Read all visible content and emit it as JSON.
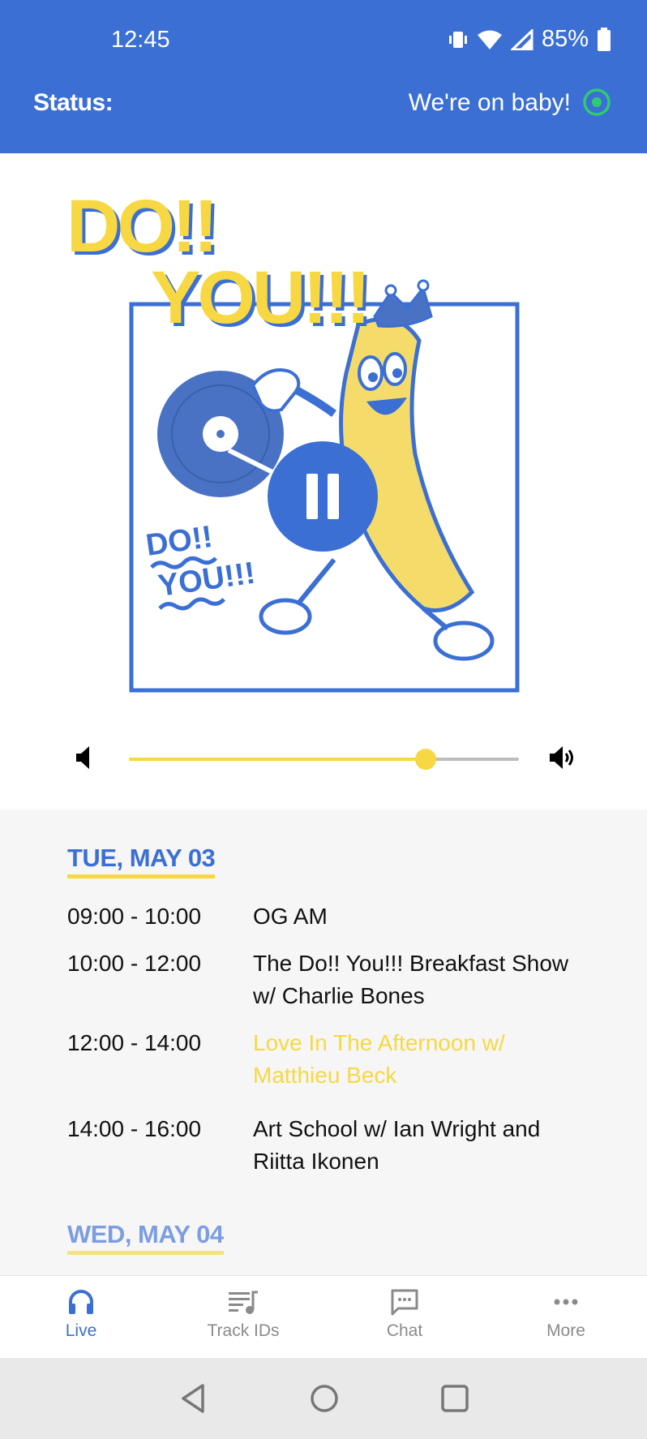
{
  "status_bar": {
    "time": "12:45",
    "battery": "85%",
    "icons": [
      "vibrate-icon",
      "wifi-icon",
      "signal-icon",
      "battery-icon"
    ]
  },
  "header": {
    "status_label": "Status:",
    "status_text": "We're on baby!",
    "status_indicator": "radio-on-icon",
    "background": "#3b6fd4"
  },
  "artwork": {
    "title_line1": "DO!!",
    "title_line2": "YOU!!!",
    "logo_small_line1": "DO!!",
    "logo_small_line2": "YOU!!!"
  },
  "player": {
    "state_icon": "pause-icon",
    "volume_level": 0.76,
    "volume_low_icon": "volume-low-icon",
    "volume_high_icon": "volume-high-icon"
  },
  "schedule": {
    "days": [
      {
        "heading": "TUE, MAY 03",
        "shows": [
          {
            "time": "09:00 - 10:00",
            "title": "OG AM",
            "current": false
          },
          {
            "time": "10:00 - 12:00",
            "title": "The Do!! You!!! Breakfast Show w/ Charlie Bones",
            "current": false
          },
          {
            "time": "12:00 - 14:00",
            "title": "Love In The Afternoon w/ Matthieu Beck",
            "current": true
          },
          {
            "time": "14:00 - 16:00",
            "title": "Art School w/ Ian Wright and Riitta Ikonen",
            "current": false
          }
        ]
      },
      {
        "heading": "WED, MAY 04",
        "shows": []
      }
    ]
  },
  "bottom_nav": {
    "items": [
      {
        "label": "Live",
        "icon": "headphones-icon",
        "active": true
      },
      {
        "label": "Track IDs",
        "icon": "playlist-icon",
        "active": false
      },
      {
        "label": "Chat",
        "icon": "chat-icon",
        "active": false
      },
      {
        "label": "More",
        "icon": "more-icon",
        "active": false
      }
    ]
  },
  "colors": {
    "accent": "#3b6fd4",
    "highlight": "#f7d842",
    "live_dot": "#2ecc71"
  }
}
